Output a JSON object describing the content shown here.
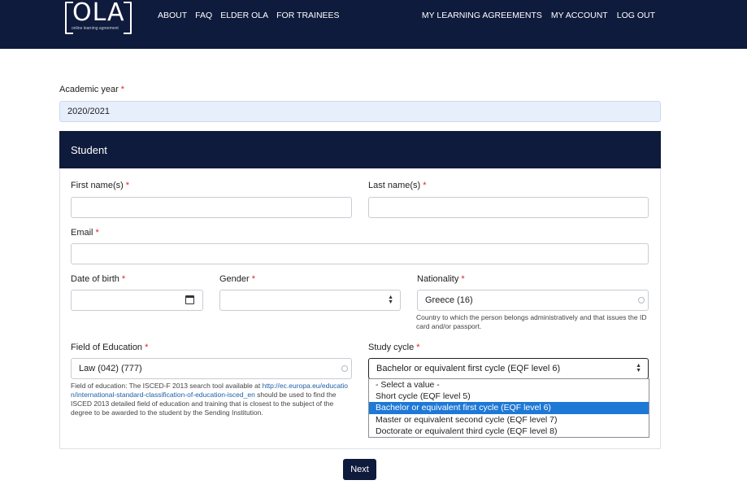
{
  "header": {
    "logo_text": "OLA",
    "logo_subtitle": "online learning agreement",
    "nav_left": [
      "About",
      "FAQ",
      "Elder OLA",
      "For Trainees"
    ],
    "nav_right": [
      "My Learning Agreements",
      "My Account",
      "Log out"
    ]
  },
  "academic_year": {
    "label": "Academic year",
    "required": "*",
    "value": "2020/2021"
  },
  "student": {
    "title": "Student",
    "first_name": {
      "label": "First name(s)",
      "value": ""
    },
    "last_name": {
      "label": "Last name(s)",
      "value": ""
    },
    "email": {
      "label": "Email",
      "value": ""
    },
    "date_of_birth": {
      "label": "Date of birth",
      "value": ""
    },
    "gender": {
      "label": "Gender",
      "value": ""
    },
    "nationality": {
      "label": "Nationality",
      "value": "Greece (16)",
      "help": "Country to which the person belongs administratively and that issues the ID card and/or passport."
    },
    "field_of_education": {
      "label": "Field of Education",
      "value": "Law (042) (777)",
      "help_pre": "Field of education: The ISCED-F 2013 search tool available at",
      "help_link": "http://ec.europa.eu/education/international-standard-classification-of-education-isced_en",
      "help_post": "should be used to find the ISCED 2013 detailed field of education and training that is closest to the subject of the degree to be awarded to the student by the Sending Institution."
    },
    "study_cycle": {
      "label": "Study cycle",
      "value": "Bachelor or equivalent first cycle (EQF level 6)",
      "options": [
        "- Select a value -",
        "Short cycle (EQF level 5)",
        "Bachelor or equivalent first cycle (EQF level 6)",
        "Master or equivalent second cycle (EQF level 7)",
        "Doctorate or equivalent third cycle (EQF level 8)"
      ],
      "selected_index": 2
    }
  },
  "actions": {
    "next_label": "Next"
  },
  "colors": {
    "navy": "#0f1b3c",
    "required": "#d9262b",
    "highlight": "#1e78d6",
    "prefilled": "#e8effc"
  }
}
